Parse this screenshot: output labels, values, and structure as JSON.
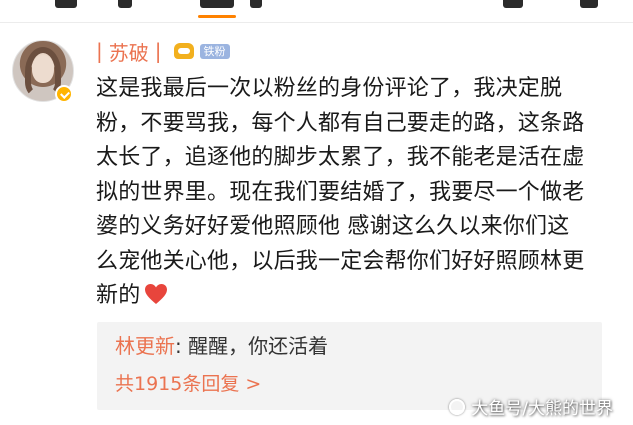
{
  "comment": {
    "username": "苏破",
    "fan_badge": "铁粉",
    "lines": [
      "这是我最后一次以粉丝的身份评论了，我决定脱",
      "粉，不要骂我，每个人都有自己要走的路，这条路",
      "太长了，追逐他的脚步太累了，我不能老是活在虚",
      "拟的世界里。现在我们要结婚了，我要尽一个做老",
      "婆的义务好好爱他照顾他 感谢这么久以来你们这",
      "么宠他关心他，以后我一定会帮你们好好照顾林更",
      "新的"
    ],
    "emoji": "heart-icon",
    "heart_color": "#e8453c"
  },
  "reply": {
    "author": "林更新",
    "separator": ":",
    "text": " 醒醒，你还活着",
    "more": "共1915条回复 >"
  },
  "watermark": {
    "text": "大鱼号/大熊的世界"
  },
  "colors": {
    "accent": "#eb7350",
    "tab_underline": "#ff8200",
    "reply_bg": "#f3f3f3"
  }
}
